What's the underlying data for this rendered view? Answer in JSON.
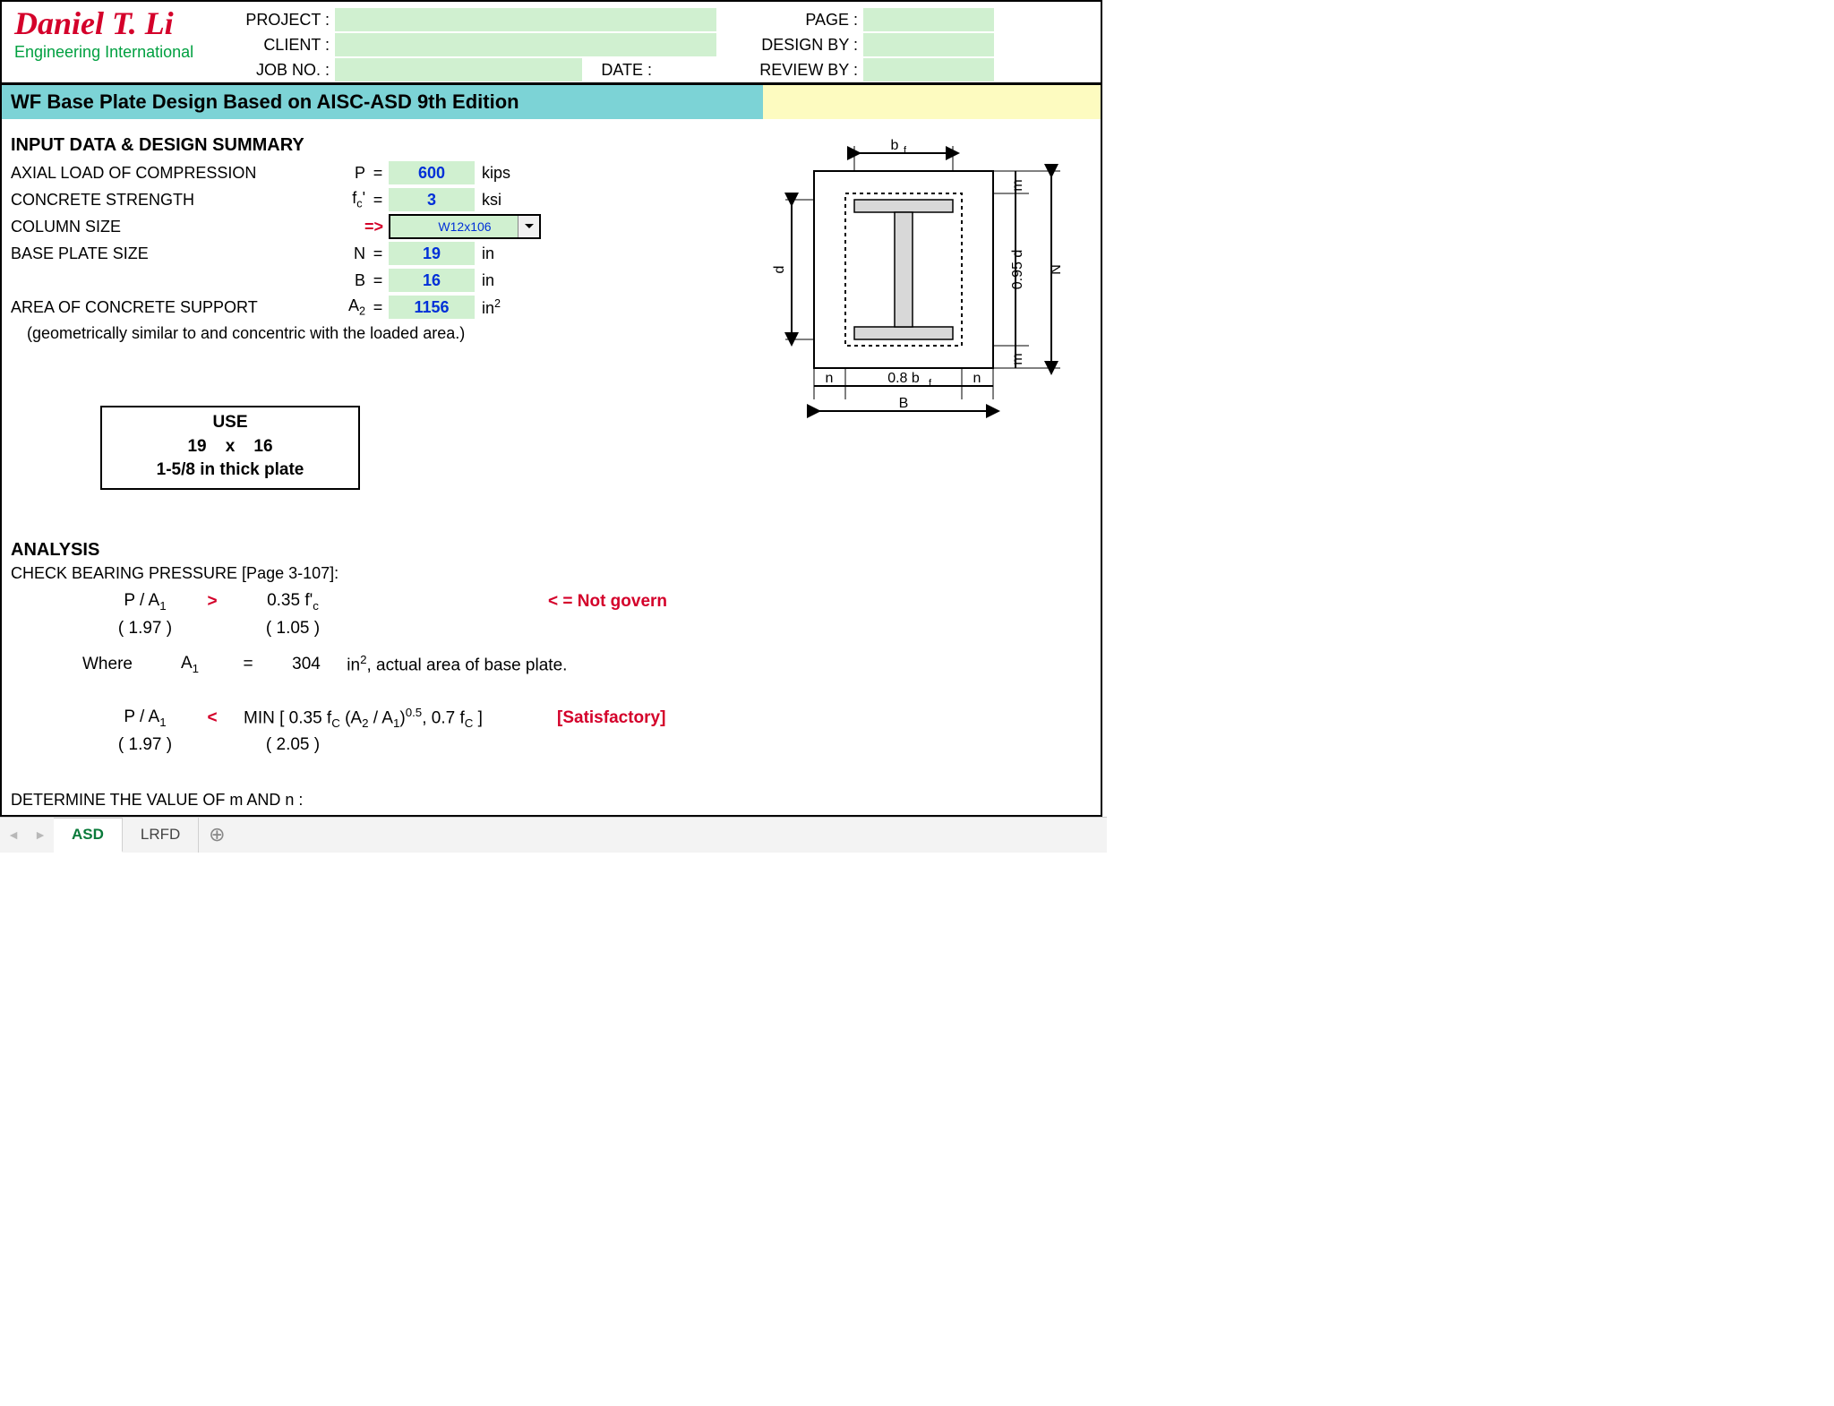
{
  "logo": {
    "name": "Daniel T. Li",
    "sub": "Engineering International"
  },
  "meta": {
    "project_label": "PROJECT :",
    "client_label": "CLIENT :",
    "jobno_label": "JOB NO. :",
    "date_label": "DATE :",
    "page_label": "PAGE :",
    "designby_label": "DESIGN BY :",
    "reviewby_label": "REVIEW BY :"
  },
  "title": "WF Base Plate Design Based on AISC-ASD 9th Edition",
  "input": {
    "heading": "INPUT DATA & DESIGN SUMMARY",
    "rows": {
      "axial": {
        "label": "AXIAL LOAD OF COMPRESSION",
        "sym": "P",
        "val": "600",
        "unit": "kips"
      },
      "fc": {
        "label": "CONCRETE STRENGTH",
        "sym_html": "f<sub>c</sub>'",
        "val": "3",
        "unit": "ksi"
      },
      "colsz": {
        "label": "COLUMN SIZE",
        "arrow": "=>",
        "dropdown": "W12x106"
      },
      "N": {
        "label": "BASE PLATE SIZE",
        "sym": "N",
        "val": "19",
        "unit": "in"
      },
      "B": {
        "sym": "B",
        "val": "16",
        "unit": "in"
      },
      "A2": {
        "label": "AREA OF CONCRETE SUPPORT",
        "sym_html": "A<sub>2</sub>",
        "val": "1156",
        "unit_html": "in<sup>2</sup>"
      }
    },
    "note": "(geometrically similar to and concentric with the loaded area.)"
  },
  "use": {
    "title": "USE",
    "dims": {
      "N": "19",
      "by": "x",
      "B": "16"
    },
    "thick": "1-5/8   in thick plate"
  },
  "analysis": {
    "heading": "ANALYSIS",
    "bearing_title": "CHECK BEARING PRESSURE [Page 3-107]:",
    "row1": {
      "left": "P / A",
      "sub1": "1",
      "op": ">",
      "right_pre": "0.35 f",
      "right_sub": "c",
      "right_ap": "'",
      "note": "< = Not govern"
    },
    "row1_vals": {
      "l": "( 1.97 )",
      "r": "( 1.05 )"
    },
    "row_where": {
      "where": "Where",
      "sym": "A",
      "sub": "1",
      "eq": "=",
      "val": "304",
      "after": "in², actual area of base plate."
    },
    "row2": {
      "left": "P / A",
      "sub1": "1",
      "op": "<",
      "mid": "MIN [ 0.35 f",
      "note": "[Satisfactory]"
    },
    "row2_full": "MIN [ 0.35 f<sub>C</sub> (A<sub>2</sub> / A<sub>1</sub>)<sup>0.5</sup>, 0.7 f<sub>C</sub> ]",
    "row2_vals": {
      "l": "( 1.97 )",
      "r": "( 2.05 )"
    },
    "mn_title": "DETERMINE THE VALUE OF m AND n :"
  },
  "diagram": {
    "bf": "b",
    "bf_sub": "f",
    "m": "m",
    "d": "d",
    "N": "N",
    "n": "n",
    "B": "B",
    "inner_d": "0.95 d",
    "inner_b": "0.8  b",
    "inner_b_sub": "f"
  },
  "tabs": {
    "asd": "ASD",
    "lrfd": "LRFD"
  }
}
